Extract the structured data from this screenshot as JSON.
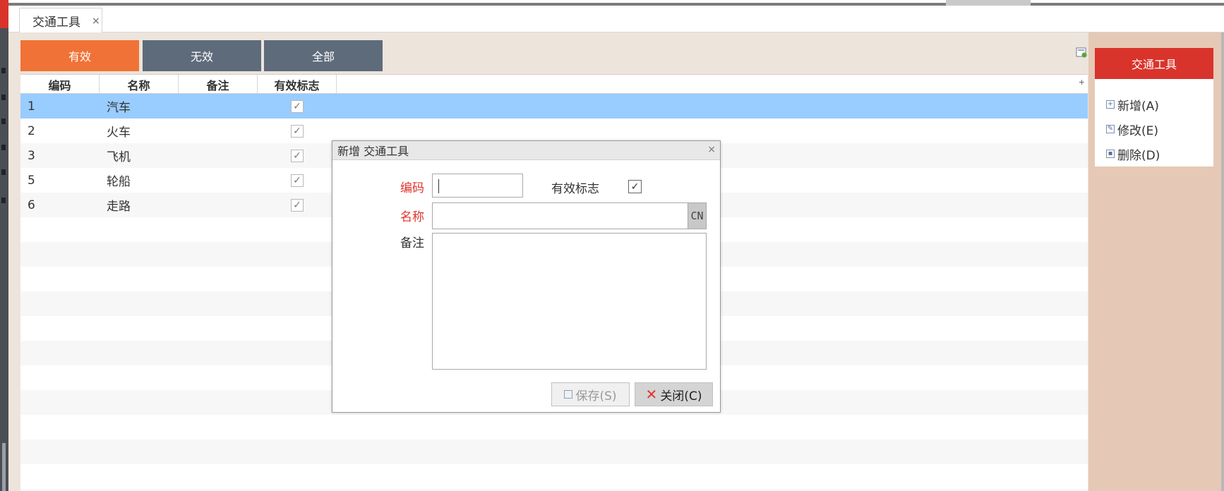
{
  "tab": {
    "label": "交通工具",
    "close": "×"
  },
  "filters": {
    "valid": "有效",
    "invalid": "无效",
    "all": "全部"
  },
  "grid": {
    "columns": [
      "编码",
      "名称",
      "备注",
      "有效标志"
    ],
    "expand_glyph": "+",
    "rows": [
      {
        "code": "1",
        "name": "汽车",
        "note": "",
        "valid": "✓",
        "selected": true
      },
      {
        "code": "2",
        "name": "火车",
        "note": "",
        "valid": "✓"
      },
      {
        "code": "3",
        "name": "飞机",
        "note": "",
        "valid": "✓"
      },
      {
        "code": "5",
        "name": "轮船",
        "note": "",
        "valid": "✓"
      },
      {
        "code": "6",
        "name": "走路",
        "note": "",
        "valid": "✓"
      }
    ]
  },
  "panel": {
    "title": "交通工具",
    "actions": [
      {
        "label": "新增(A)",
        "icon": "add-icon",
        "glyph": "+"
      },
      {
        "label": "修改(E)",
        "icon": "edit-icon",
        "glyph": "✎"
      },
      {
        "label": "删除(D)",
        "icon": "delete-icon",
        "glyph": "▪"
      }
    ]
  },
  "dialog": {
    "title": "新增 交通工具",
    "close": "×",
    "labels": {
      "code": "编码",
      "name": "名称",
      "note": "备注",
      "valid": "有效标志"
    },
    "fields": {
      "code": "",
      "name": "",
      "note": "",
      "valid_checked": "✓"
    },
    "cn_label": "CN",
    "save_label": "保存(S)",
    "close_label": "关闭(C)",
    "close_glyph": "✕"
  },
  "colors": {
    "accent_orange": "#f07236",
    "slate": "#5e6b7b",
    "brand_red": "#d9342b",
    "selection": "#99ccff"
  }
}
